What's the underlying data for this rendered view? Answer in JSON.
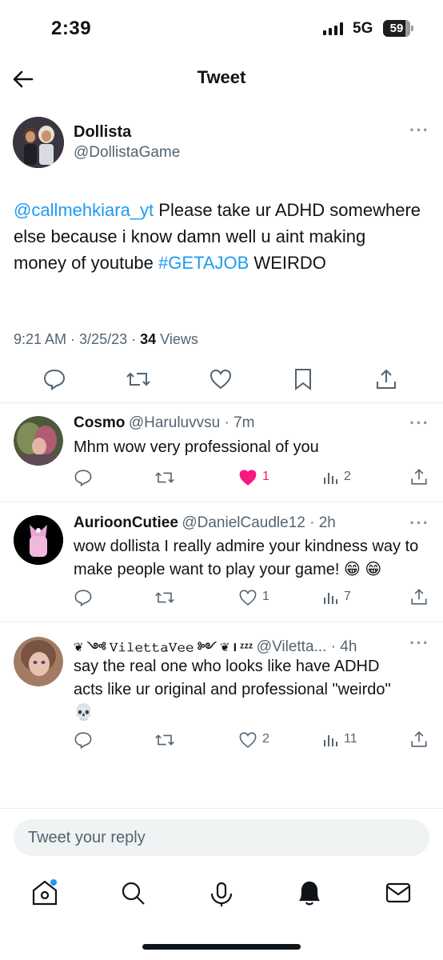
{
  "status_bar": {
    "time": "2:39",
    "network": "5G",
    "battery": "59"
  },
  "header": {
    "title": "Tweet"
  },
  "main_tweet": {
    "name": "Dollista",
    "handle": "@DollistaGame",
    "mention": "@callmehkiara_yt",
    "text_part1": " Please take ur ADHD somewhere else because i know damn well u aint making money of youtube ",
    "hashtag": "#GETAJOB",
    "text_part2": " WEIRDO",
    "time": "9:21 AM",
    "date": "3/25/23",
    "views_count": "34",
    "views_label": "Views"
  },
  "replies": [
    {
      "name": "Cosmo",
      "handle": "@Haruluvvsu",
      "time": "7m",
      "text": "Mhm wow very professional of you",
      "likes": "1",
      "views": "2",
      "liked": true
    },
    {
      "name": "AurioonCutiee",
      "handle": "@DanielCaudle12",
      "time": "2h",
      "text": "wow dollista I really admire your kindness way to make people want to play your game! 😁 😁",
      "likes": "1",
      "views": "7",
      "liked": false
    },
    {
      "name": "❦ ༺ 𝚅𝚒𝚕𝚎𝚝𝚝𝚊𝚅𝚎𝚎 ༻ ❦ I ᶻᶻᶻ",
      "handle": "@Viletta...",
      "time": "4h",
      "text": "say the real one who looks like have ADHD acts like ur original and professional \"weirdo\" 💀",
      "likes": "2",
      "views": "11",
      "liked": false
    }
  ],
  "reply_box": {
    "placeholder": "Tweet your reply"
  },
  "colors": {
    "accent": "#1d9bf0",
    "like": "#f91880",
    "text": "#0f1419",
    "muted": "#536471"
  },
  "icons": [
    "back-arrow-icon",
    "more-icon",
    "reply-icon",
    "retweet-icon",
    "like-icon",
    "bookmark-icon",
    "share-icon",
    "views-icon",
    "home-icon",
    "search-icon",
    "spaces-icon",
    "notifications-icon",
    "messages-icon"
  ]
}
